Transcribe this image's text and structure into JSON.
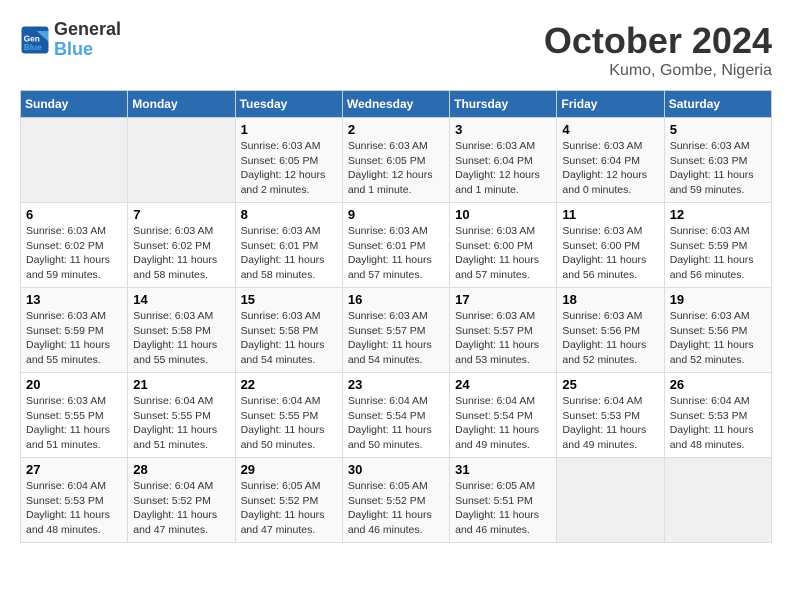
{
  "logo": {
    "line1": "General",
    "line2": "Blue"
  },
  "title": "October 2024",
  "subtitle": "Kumo, Gombe, Nigeria",
  "days_header": [
    "Sunday",
    "Monday",
    "Tuesday",
    "Wednesday",
    "Thursday",
    "Friday",
    "Saturday"
  ],
  "weeks": [
    [
      {
        "day": "",
        "info": ""
      },
      {
        "day": "",
        "info": ""
      },
      {
        "day": "1",
        "info": "Sunrise: 6:03 AM\nSunset: 6:05 PM\nDaylight: 12 hours\nand 2 minutes."
      },
      {
        "day": "2",
        "info": "Sunrise: 6:03 AM\nSunset: 6:05 PM\nDaylight: 12 hours\nand 1 minute."
      },
      {
        "day": "3",
        "info": "Sunrise: 6:03 AM\nSunset: 6:04 PM\nDaylight: 12 hours\nand 1 minute."
      },
      {
        "day": "4",
        "info": "Sunrise: 6:03 AM\nSunset: 6:04 PM\nDaylight: 12 hours\nand 0 minutes."
      },
      {
        "day": "5",
        "info": "Sunrise: 6:03 AM\nSunset: 6:03 PM\nDaylight: 11 hours\nand 59 minutes."
      }
    ],
    [
      {
        "day": "6",
        "info": "Sunrise: 6:03 AM\nSunset: 6:02 PM\nDaylight: 11 hours\nand 59 minutes."
      },
      {
        "day": "7",
        "info": "Sunrise: 6:03 AM\nSunset: 6:02 PM\nDaylight: 11 hours\nand 58 minutes."
      },
      {
        "day": "8",
        "info": "Sunrise: 6:03 AM\nSunset: 6:01 PM\nDaylight: 11 hours\nand 58 minutes."
      },
      {
        "day": "9",
        "info": "Sunrise: 6:03 AM\nSunset: 6:01 PM\nDaylight: 11 hours\nand 57 minutes."
      },
      {
        "day": "10",
        "info": "Sunrise: 6:03 AM\nSunset: 6:00 PM\nDaylight: 11 hours\nand 57 minutes."
      },
      {
        "day": "11",
        "info": "Sunrise: 6:03 AM\nSunset: 6:00 PM\nDaylight: 11 hours\nand 56 minutes."
      },
      {
        "day": "12",
        "info": "Sunrise: 6:03 AM\nSunset: 5:59 PM\nDaylight: 11 hours\nand 56 minutes."
      }
    ],
    [
      {
        "day": "13",
        "info": "Sunrise: 6:03 AM\nSunset: 5:59 PM\nDaylight: 11 hours\nand 55 minutes."
      },
      {
        "day": "14",
        "info": "Sunrise: 6:03 AM\nSunset: 5:58 PM\nDaylight: 11 hours\nand 55 minutes."
      },
      {
        "day": "15",
        "info": "Sunrise: 6:03 AM\nSunset: 5:58 PM\nDaylight: 11 hours\nand 54 minutes."
      },
      {
        "day": "16",
        "info": "Sunrise: 6:03 AM\nSunset: 5:57 PM\nDaylight: 11 hours\nand 54 minutes."
      },
      {
        "day": "17",
        "info": "Sunrise: 6:03 AM\nSunset: 5:57 PM\nDaylight: 11 hours\nand 53 minutes."
      },
      {
        "day": "18",
        "info": "Sunrise: 6:03 AM\nSunset: 5:56 PM\nDaylight: 11 hours\nand 52 minutes."
      },
      {
        "day": "19",
        "info": "Sunrise: 6:03 AM\nSunset: 5:56 PM\nDaylight: 11 hours\nand 52 minutes."
      }
    ],
    [
      {
        "day": "20",
        "info": "Sunrise: 6:03 AM\nSunset: 5:55 PM\nDaylight: 11 hours\nand 51 minutes."
      },
      {
        "day": "21",
        "info": "Sunrise: 6:04 AM\nSunset: 5:55 PM\nDaylight: 11 hours\nand 51 minutes."
      },
      {
        "day": "22",
        "info": "Sunrise: 6:04 AM\nSunset: 5:55 PM\nDaylight: 11 hours\nand 50 minutes."
      },
      {
        "day": "23",
        "info": "Sunrise: 6:04 AM\nSunset: 5:54 PM\nDaylight: 11 hours\nand 50 minutes."
      },
      {
        "day": "24",
        "info": "Sunrise: 6:04 AM\nSunset: 5:54 PM\nDaylight: 11 hours\nand 49 minutes."
      },
      {
        "day": "25",
        "info": "Sunrise: 6:04 AM\nSunset: 5:53 PM\nDaylight: 11 hours\nand 49 minutes."
      },
      {
        "day": "26",
        "info": "Sunrise: 6:04 AM\nSunset: 5:53 PM\nDaylight: 11 hours\nand 48 minutes."
      }
    ],
    [
      {
        "day": "27",
        "info": "Sunrise: 6:04 AM\nSunset: 5:53 PM\nDaylight: 11 hours\nand 48 minutes."
      },
      {
        "day": "28",
        "info": "Sunrise: 6:04 AM\nSunset: 5:52 PM\nDaylight: 11 hours\nand 47 minutes."
      },
      {
        "day": "29",
        "info": "Sunrise: 6:05 AM\nSunset: 5:52 PM\nDaylight: 11 hours\nand 47 minutes."
      },
      {
        "day": "30",
        "info": "Sunrise: 6:05 AM\nSunset: 5:52 PM\nDaylight: 11 hours\nand 46 minutes."
      },
      {
        "day": "31",
        "info": "Sunrise: 6:05 AM\nSunset: 5:51 PM\nDaylight: 11 hours\nand 46 minutes."
      },
      {
        "day": "",
        "info": ""
      },
      {
        "day": "",
        "info": ""
      }
    ]
  ]
}
